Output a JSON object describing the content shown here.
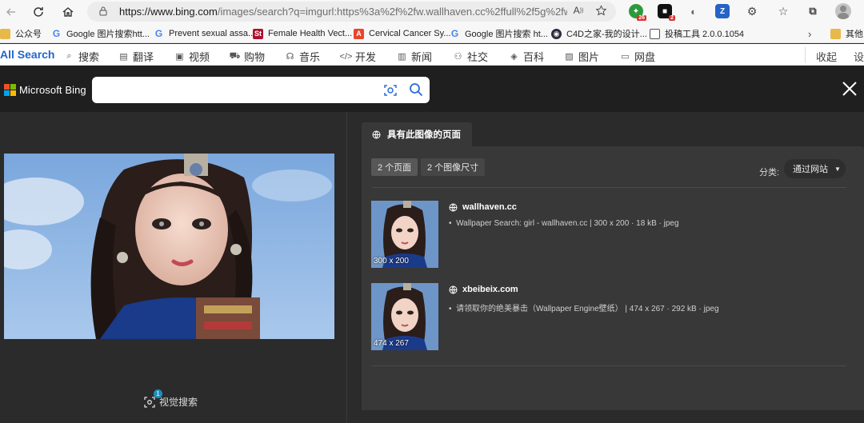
{
  "browser": {
    "url_host": "https://www.bing.com",
    "url_rest": "/images/search?q=imgurl:https%3a%2f%2fw.wallhaven.cc%2ffull%2f5g%2fwallhaven...",
    "bookmarks": [
      {
        "label": "公众号",
        "icon": "folder-icon"
      },
      {
        "label": "Google 图片搜索htt...",
        "icon": "google-icon"
      },
      {
        "label": "Prevent sexual assa...",
        "icon": "google-icon"
      },
      {
        "label": "Female Health Vect...",
        "icon": "stock-icon"
      },
      {
        "label": "Cervical Cancer Sy...",
        "icon": "adobe-icon"
      },
      {
        "label": "Google 图片搜索 ht...",
        "icon": "google-icon"
      },
      {
        "label": "C4D之家-我的设计...",
        "icon": "c4d-icon"
      },
      {
        "label": "投稿工具 2.0.0.1054",
        "icon": "document-icon"
      },
      {
        "label": "其他",
        "icon": "folder-icon"
      }
    ],
    "ext_badges": [
      "26",
      "2"
    ]
  },
  "search_toolbar": {
    "all_search": "All Search",
    "items": [
      "搜索",
      "翻译",
      "视频",
      "购物",
      "音乐",
      "开发",
      "新闻",
      "社交",
      "百科",
      "图片",
      "网盘"
    ],
    "collapse": "收起",
    "settings": "设"
  },
  "bing": {
    "logo_text": "Microsoft Bing",
    "search_value": "",
    "visual_search_label": "视觉搜索",
    "visual_search_badge": "1"
  },
  "pages_panel": {
    "tab_label": "具有此图像的页面",
    "pill_pages": "2 个页面",
    "pill_sizes": "2 个图像尺寸",
    "sort_label": "分类:",
    "sort_value": "通过网站",
    "results": [
      {
        "site": "wallhaven.cc",
        "desc": "Wallpaper Search: girl - wallhaven.cc | 300 x 200 · 18 kB · jpeg",
        "size": "300 x 200"
      },
      {
        "site": "xbeibeix.com",
        "desc": "请领取你的绝美暴击（Wallpaper Engine壁纸） | 474 x 267 · 292 kB · jpeg",
        "size": "474 x 267"
      }
    ]
  }
}
